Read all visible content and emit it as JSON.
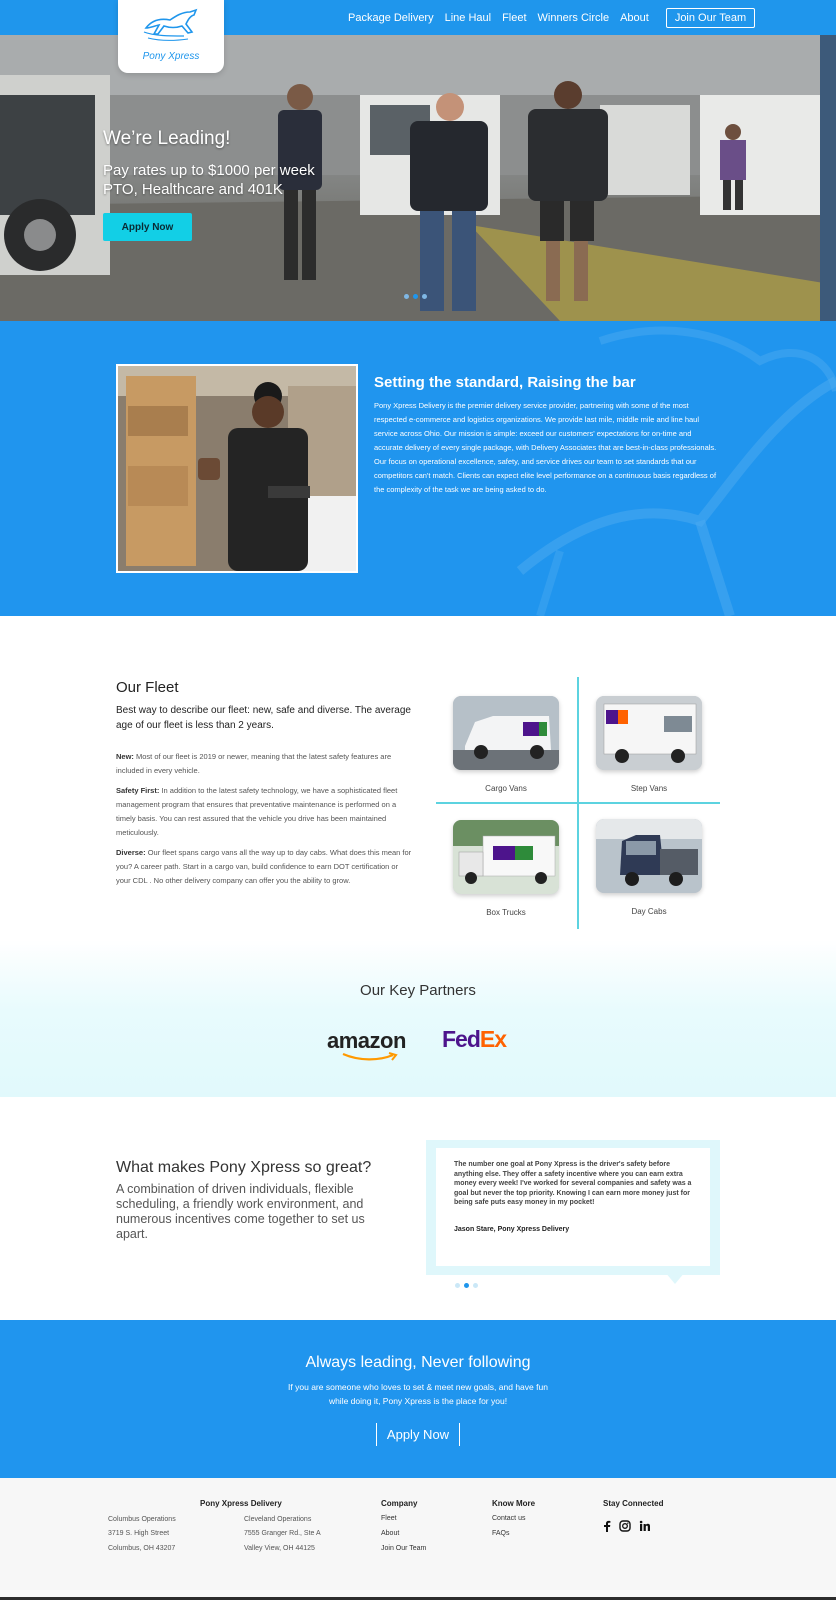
{
  "brand": {
    "logo_text": "Pony Xpress"
  },
  "nav": {
    "links": [
      "Package Delivery",
      "Line Haul",
      "Fleet",
      "Winners Circle",
      "About"
    ],
    "cta": "Join Our Team"
  },
  "hero": {
    "title": "We’re Leading!",
    "subtitle_line1": "Pay rates up to $1000 per week",
    "subtitle_line2": "PTO, Healthcare and 401K",
    "button": "Apply Now",
    "slides": 3,
    "active_slide": 2
  },
  "about": {
    "title": "Setting the standard, Raising the bar",
    "text": "Pony Xpress Delivery is the premier delivery service provider, partnering with some of the most respected e-commerce and logistics organizations. We provide last mile, middle mile and line haul service across Ohio. Our mission is simple: exceed our customers' expectations for on-time and accurate delivery of every single package, with Delivery Associates that are best-in-class professionals. Our focus on operational excellence, safety, and service drives our team to set standards that our competitors can't match. Clients can expect elite level performance on a continuous basis regardless of the complexity of the task we are being asked to do."
  },
  "fleet": {
    "title": "Our Fleet",
    "lead": "Best way to describe our fleet: new, safe and diverse. The average age of our fleet is less than 2 years.",
    "points": [
      {
        "label": "New:",
        "text": " Most of our fleet is 2019 or newer, meaning that the latest safety features are included in every vehicle."
      },
      {
        "label": "Safety First:",
        "text": " In addition to the latest safety technology, we have a sophisticated fleet management program that ensures that preventative maintenance is performed on a timely basis. You can rest assured that the vehicle you drive has been maintained meticulously."
      },
      {
        "label": "Diverse:",
        "text": " Our fleet spans cargo vans all the way up to day cabs. What does this mean for you? A career path. Start in a cargo van, build confidence to earn DOT certification or your CDL . No other delivery company can offer you the ability to grow."
      }
    ],
    "vehicles": [
      "Cargo Vans",
      "Step Vans",
      "Box Trucks",
      "Day Cabs"
    ]
  },
  "partners": {
    "title": "Our Key Partners",
    "amazon": "amazon",
    "fedex_fe": "Fed",
    "fedex_ex": "Ex"
  },
  "great": {
    "title": "What makes Pony Xpress so great?",
    "text": "A combination of driven individuals, flexible scheduling, a friendly work environment, and numerous incentives come together to set us apart.",
    "quote": "The number one goal at Pony Xpress is the driver's safety before anything else. They offer a safety incentive where you can earn extra money every week! I've worked for several companies and safety was a goal but never the top priority. Knowing I can earn more money just for being safe puts easy money in my pocket!",
    "author": "Jason Stare, Pony Xpress Delivery",
    "slides": 3,
    "active_slide": 2
  },
  "cta": {
    "title": "Always leading, Never following",
    "text": "If you are someone who loves to set & meet new goals, and have fun while doing it, Pony Xpress is the place for you!",
    "button": "Apply Now"
  },
  "footer": {
    "company_name": "Pony Xpress Delivery",
    "columbus": {
      "name": "Columbus Operations",
      "street": "3719 S. High Street",
      "city": "Columbus, OH 43207"
    },
    "cleveland": {
      "name": "Cleveland Operations",
      "street": "7555 Granger Rd., Ste A",
      "city": "Valley View, OH 44125"
    },
    "company_head": "Company",
    "company_links": [
      "Fleet",
      "About",
      "Join Our Team"
    ],
    "know_head": "Know More",
    "know_links": [
      "Contact us",
      "FAQs"
    ],
    "social_head": "Stay Connected",
    "social_icons": [
      "facebook-icon",
      "instagram-icon",
      "linkedin-icon"
    ]
  },
  "colors": {
    "brand_blue": "#1f96ec",
    "cyan": "#12cfe6",
    "fedex_purple": "#4d148c",
    "fedex_orange": "#ff6200"
  }
}
